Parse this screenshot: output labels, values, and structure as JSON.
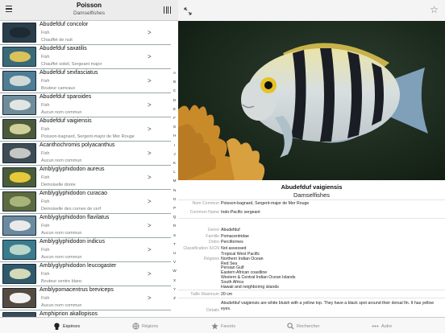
{
  "left_header": {
    "title": "Poisson",
    "subtitle": "Damselfishes"
  },
  "species_list": [
    {
      "name": "Abudefduf concolor",
      "category": "Fish",
      "common": "Chauffet de nuit",
      "bg": "#2a3d4a",
      "fish": "#1d2a33"
    },
    {
      "name": "Abudefduf saxatilis",
      "category": "Fish",
      "common": "Chauffet soleil, Sergeant major",
      "bg": "#3a6a7a",
      "fish": "#d9c25a"
    },
    {
      "name": "Abudefduf sexfasciatus",
      "category": "Fish",
      "common": "Bouteur carreaux",
      "bg": "#4e7d94",
      "fish": "#cfd9d6"
    },
    {
      "name": "Abudefduf sparoides",
      "category": "Fish",
      "common": "Aucun nom commun",
      "bg": "#6f8c9a",
      "fish": "#e1e6e4"
    },
    {
      "name": "Abudefduf vaigiensis",
      "category": "Fish",
      "common": "Poisson-bagnard, Sergent-major de Mer Rouge",
      "bg": "#4b5a3a",
      "fish": "#cfcf9a"
    },
    {
      "name": "Acanthochromis polyacanthus",
      "category": "Fish",
      "common": "Aucun nom commun",
      "bg": "#3d4c55",
      "fish": "#c4c7c4"
    },
    {
      "name": "Amblyglyphidodon aureus",
      "category": "Fish",
      "common": "Demoiselle dorée",
      "bg": "#4a5c3a",
      "fish": "#e6c93a"
    },
    {
      "name": "Amblyglyphidodon curacao",
      "category": "Fish",
      "common": "Demoiselle des cornes de cerf",
      "bg": "#5e6a40",
      "fish": "#a9b47a"
    },
    {
      "name": "Amblyglyphidodon flavilatus",
      "category": "Fish",
      "common": "Aucun nom commun",
      "bg": "#6a8aa0",
      "fish": "#eaeaea"
    },
    {
      "name": "Amblyglyphidodon indicus",
      "category": "Fish",
      "common": "Aucun nom commun",
      "bg": "#3a7c8e",
      "fish": "#b8d7c8"
    },
    {
      "name": "Amblyglyphidodon leucogaster",
      "category": "Fish",
      "common": "Bouteur ventre blanc",
      "bg": "#2e5a6c",
      "fish": "#d4d9b8"
    },
    {
      "name": "Amblypomacentrus breviceps",
      "category": "Fish",
      "common": "Aucun nom commun",
      "bg": "#554a40",
      "fish": "#f2f2f2"
    },
    {
      "name": "Amphiprion akallopisos",
      "category": "",
      "common": "",
      "bg": "#3a4c5a",
      "fish": "#d08a3a"
    }
  ],
  "index_letters": [
    "A",
    "B",
    "C",
    "D",
    "E",
    "F",
    "G",
    "H",
    "I",
    "J",
    "K",
    "L",
    "M",
    "N",
    "O",
    "P",
    "Q",
    "R",
    "S",
    "T",
    "U",
    "V",
    "W",
    "X",
    "Y",
    "Z"
  ],
  "detail": {
    "scientific_name": "Abudefduf vaigiensis",
    "family": "Damselfishes",
    "rows": [
      {
        "label": "Nom Commun",
        "value": "Poisson-bagnard, Sergent-major de Mer Rouge"
      },
      {
        "label": "Common Name",
        "value": "Indo-Pacific sergeant"
      }
    ],
    "taxonomy": [
      {
        "label": "Genre",
        "value": "Abudefduf"
      },
      {
        "label": "Famille",
        "value": "Pomacentridae"
      },
      {
        "label": "Ordre",
        "value": "Perciformes"
      },
      {
        "label": "Classification IUCN",
        "value": "Not assessed"
      }
    ],
    "regions_label": "Régions",
    "regions": [
      "Tropical West Pacific",
      "Northern Indian Ocean",
      "Red Sea",
      "Persian Gulf",
      "Eastern African coastline",
      "Western & Central Indian Ocean Islands",
      "South Africa",
      "Hawaii and neighboring islands"
    ],
    "size_label": "Taille Maximum",
    "size_value": "20 cm",
    "details_label": "Details",
    "details_text": "Abudefduf vaigiensis are white bluish with a yellow top. They have a black spot around their dorsal fin. It has yellow eyes."
  },
  "tabs": [
    {
      "label": "Espèces",
      "icon": "fish-icon",
      "active": true
    },
    {
      "label": "Régions",
      "icon": "globe-icon",
      "active": false
    },
    {
      "label": "Favoris",
      "icon": "star-icon",
      "active": false
    },
    {
      "label": "Rechercher",
      "icon": "search-icon",
      "active": false
    },
    {
      "label": "Autre",
      "icon": "more-icon",
      "active": false
    }
  ]
}
